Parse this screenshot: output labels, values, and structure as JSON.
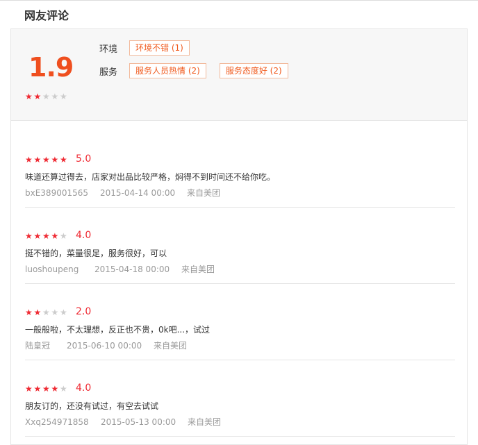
{
  "section": {
    "title": "网友评论"
  },
  "summary": {
    "score": "1.9",
    "star_rating": 2,
    "tag_groups": [
      {
        "label": "环境",
        "tags": [
          "环境不错 (1)"
        ]
      },
      {
        "label": "服务",
        "tags": [
          "服务人员热情 (2)",
          "服务态度好 (2)"
        ]
      }
    ]
  },
  "reviews": [
    {
      "stars": 5,
      "score": "5.0",
      "text": "味道还算过得去，店家对出品比较严格，焖得不到时间还不给你吃。",
      "user": "bxE389001565",
      "time": "2015-04-14 00:00",
      "source": "来自美团"
    },
    {
      "stars": 4,
      "score": "4.0",
      "text": "挺不错的，菜量很足，服务很好，可以",
      "user": "luoshoupeng",
      "time": "2015-04-18 00:00",
      "source": "来自美团"
    },
    {
      "stars": 2,
      "score": "2.0",
      "text": "一般般啦，不太理想，反正也不贵，0k吧...，试过",
      "user": "陆皇冠",
      "time": "2015-06-10 00:00",
      "source": "来自美团"
    },
    {
      "stars": 4,
      "score": "4.0",
      "text": "朋友订的，还没有试过，有空去试试",
      "user": "Xxq254971858",
      "time": "2015-05-13 00:00",
      "source": "来自美团"
    }
  ],
  "colors": {
    "accent": "#ef4f1f",
    "star_on": "#ef2a33",
    "star_off": "#cccccc",
    "tag_border": "#f2b99b"
  },
  "icons": {
    "star": "star-icon"
  }
}
